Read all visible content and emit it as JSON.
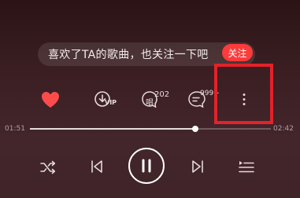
{
  "tip": {
    "text": "喜欢了TA的歌曲，也关注一下吧",
    "follow_label": "关注"
  },
  "actions": {
    "like_color": "#ff4b4b",
    "download_badge": "VIP",
    "sing_label": "唱",
    "sing_count": "202",
    "comment_count": "999+"
  },
  "progress": {
    "current_time": "01:51",
    "total_time": "02:42",
    "fraction": 0.685
  },
  "controls": {
    "mode_icon": "shuffle-icon",
    "prev_icon": "previous-icon",
    "play_icon": "pause-icon",
    "next_icon": "next-icon",
    "playlist_icon": "playlist-icon"
  },
  "colors": {
    "accent": "#ff3a3a",
    "highlight_box": "#e2222a"
  }
}
